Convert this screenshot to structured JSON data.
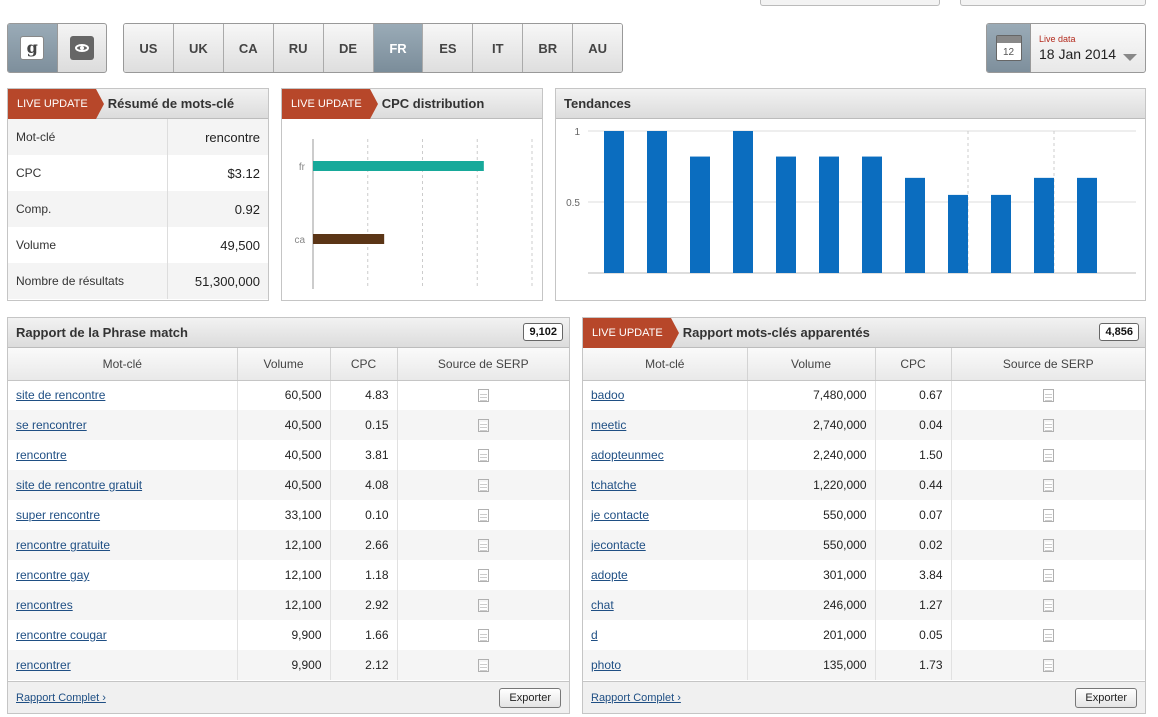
{
  "engines": [
    {
      "name": "google",
      "icon": "google-g-icon",
      "glyph": "g",
      "active": true
    },
    {
      "name": "bing",
      "icon": "eye-icon",
      "active": false
    }
  ],
  "countries": [
    {
      "code": "US",
      "active": false
    },
    {
      "code": "UK",
      "active": false
    },
    {
      "code": "CA",
      "active": false
    },
    {
      "code": "RU",
      "active": false
    },
    {
      "code": "DE",
      "active": false
    },
    {
      "code": "FR",
      "active": true
    },
    {
      "code": "ES",
      "active": false
    },
    {
      "code": "IT",
      "active": false
    },
    {
      "code": "BR",
      "active": false
    },
    {
      "code": "AU",
      "active": false
    }
  ],
  "date": {
    "label": "Live data",
    "value": "18 Jan 2014",
    "icon_day": "12"
  },
  "live_label": "LIVE UPDATE",
  "resume": {
    "title": "Résumé de mots-clé",
    "rows": [
      {
        "k": "Mot-clé",
        "v": "rencontre"
      },
      {
        "k": "CPC",
        "v": "$3.12"
      },
      {
        "k": "Comp.",
        "v": "0.92"
      },
      {
        "k": "Volume",
        "v": "49,500"
      },
      {
        "k": "Nombre de résultats",
        "v": "51,300,000"
      }
    ]
  },
  "cpc": {
    "title": "CPC distribution",
    "chart_data": {
      "type": "bar",
      "orientation": "horizontal",
      "categories": [
        "fr",
        "ca"
      ],
      "values": [
        3.12,
        1.3
      ],
      "colors": [
        "#17a99a",
        "#5b3516"
      ],
      "xlim": [
        0,
        4
      ],
      "xticks": [
        "0",
        "1",
        "2",
        "3",
        "4"
      ]
    }
  },
  "trends": {
    "title": "Tendances",
    "chart_data": {
      "type": "bar",
      "values": [
        1,
        1,
        0.82,
        1,
        0.82,
        0.82,
        0.82,
        0.67,
        0.55,
        0.55,
        0.67,
        0.67
      ],
      "ylim": [
        0,
        1
      ],
      "yticks": [
        "0.5",
        "1"
      ],
      "color": "#0b6dbf"
    }
  },
  "phrase": {
    "title": "Rapport de la Phrase match",
    "count": "9,102",
    "columns": [
      "Mot-clé",
      "Volume",
      "CPC",
      "Source de SERP"
    ],
    "rows": [
      {
        "kw": "site de rencontre",
        "vol": "60,500",
        "cpc": "4.83"
      },
      {
        "kw": "se rencontrer",
        "vol": "40,500",
        "cpc": "0.15"
      },
      {
        "kw": "rencontre",
        "vol": "40,500",
        "cpc": "3.81"
      },
      {
        "kw": "site de rencontre gratuit",
        "vol": "40,500",
        "cpc": "4.08"
      },
      {
        "kw": "super rencontre",
        "vol": "33,100",
        "cpc": "0.10"
      },
      {
        "kw": "rencontre gratuite",
        "vol": "12,100",
        "cpc": "2.66"
      },
      {
        "kw": "rencontre gay",
        "vol": "12,100",
        "cpc": "1.18"
      },
      {
        "kw": "rencontres",
        "vol": "12,100",
        "cpc": "2.92"
      },
      {
        "kw": "rencontre cougar",
        "vol": "9,900",
        "cpc": "1.66"
      },
      {
        "kw": "rencontrer",
        "vol": "9,900",
        "cpc": "2.12"
      }
    ],
    "full_report": "Rapport Complet ›",
    "export": "Exporter"
  },
  "related": {
    "title": "Rapport mots-clés apparentés",
    "count": "4,856",
    "columns": [
      "Mot-clé",
      "Volume",
      "CPC",
      "Source de SERP"
    ],
    "rows": [
      {
        "kw": "badoo",
        "vol": "7,480,000",
        "cpc": "0.67"
      },
      {
        "kw": "meetic",
        "vol": "2,740,000",
        "cpc": "0.04"
      },
      {
        "kw": "adopteunmec",
        "vol": "2,240,000",
        "cpc": "1.50"
      },
      {
        "kw": "tchatche",
        "vol": "1,220,000",
        "cpc": "0.44"
      },
      {
        "kw": "je contacte",
        "vol": "550,000",
        "cpc": "0.07"
      },
      {
        "kw": "jecontacte",
        "vol": "550,000",
        "cpc": "0.02"
      },
      {
        "kw": "adopte",
        "vol": "301,000",
        "cpc": "3.84"
      },
      {
        "kw": "chat",
        "vol": "246,000",
        "cpc": "1.27"
      },
      {
        "kw": "d",
        "vol": "201,000",
        "cpc": "0.05"
      },
      {
        "kw": "photo",
        "vol": "135,000",
        "cpc": "1.73"
      }
    ],
    "full_report": "Rapport Complet ›",
    "export": "Exporter"
  }
}
